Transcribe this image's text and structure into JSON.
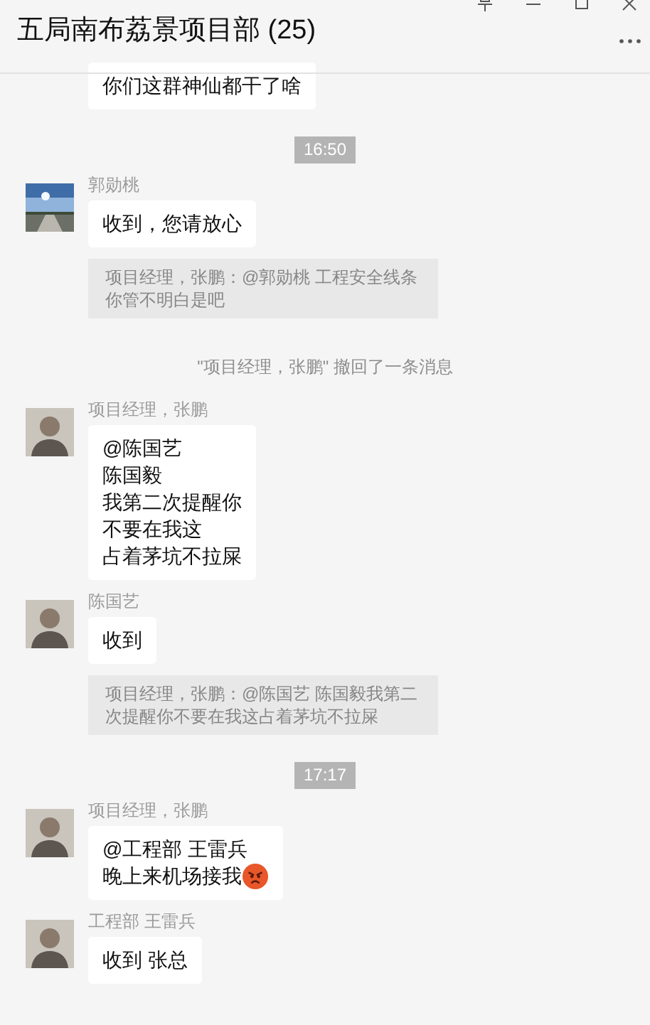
{
  "window": {
    "title": "五局南布荔景项目部 (25)"
  },
  "messages": [
    {
      "kind": "bubble",
      "lines": [
        "你们这群神仙都干了啥"
      ],
      "angry_emoji": false
    },
    {
      "kind": "time",
      "text": "16:50"
    },
    {
      "kind": "bubble",
      "sender": "郭勋桃",
      "avatar": {
        "kind": "picture"
      },
      "lines": [
        "收到，您请放心"
      ],
      "angry_emoji": false
    },
    {
      "kind": "quote",
      "text": "项目经理，张鹏：@郭勋桃 工程安全线条你管不明白是吧"
    },
    {
      "kind": "system",
      "text": "\"项目经理，张鹏\" 撤回了一条消息"
    },
    {
      "kind": "bubble",
      "sender": "项目经理，张鹏",
      "avatar": {
        "kind": "silhouette"
      },
      "lines": [
        "@陈国艺",
        "陈国毅",
        "我第二次提醒你",
        "不要在我这",
        "占着茅坑不拉屎"
      ],
      "angry_emoji": false
    },
    {
      "kind": "bubble",
      "sender": "陈国艺",
      "avatar": {
        "kind": "silhouette"
      },
      "lines": [
        "收到"
      ],
      "angry_emoji": false
    },
    {
      "kind": "quote",
      "text": "项目经理，张鹏：@陈国艺 陈国毅我第二次提醒你不要在我这占着茅坑不拉屎"
    },
    {
      "kind": "time",
      "text": "17:17"
    },
    {
      "kind": "bubble",
      "sender": "项目经理，张鹏",
      "avatar": {
        "kind": "silhouette"
      },
      "lines": [
        "@工程部 王雷兵",
        "晚上来机场接我"
      ],
      "angry_emoji": true
    },
    {
      "kind": "bubble",
      "sender": "工程部 王雷兵",
      "avatar": {
        "kind": "silhouette"
      },
      "lines": [
        "收到 张总"
      ],
      "angry_emoji": false
    }
  ]
}
